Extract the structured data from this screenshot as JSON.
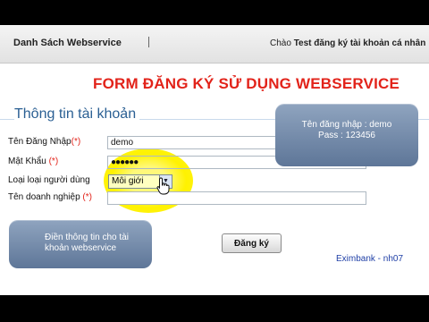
{
  "header": {
    "title": "Danh Sách Webservice",
    "greeting_prefix": "Chào",
    "greeting_rest": "Test đăng ký tài khoản cá nhân"
  },
  "form": {
    "title": "FORM ĐĂNG KÝ SỬ DỤNG WEBSERVICE",
    "section": "Thông tin tài khoản",
    "required_mark": "(*)",
    "fields": [
      {
        "label": "Tên Đăng Nhập",
        "value": "demo"
      },
      {
        "label": "Mật Khẩu",
        "value": "●●●●●●"
      },
      {
        "label": "Loại loại người dùng",
        "value": "Môi giới"
      },
      {
        "label": "Tên doanh nghiệp",
        "value": ""
      }
    ],
    "submit_label": "Đăng ký"
  },
  "annotations": {
    "login_hint_line1": "Tên đăng nhập : demo",
    "login_hint_line2": "Pass : 123456",
    "instruction": "Điền thông tin cho tài khoản webservice"
  },
  "footer": {
    "credit": "Eximbank - nh07"
  },
  "colors": {
    "title_red": "#e2231a",
    "section_blue": "#2a5f93",
    "highlight_yellow": "#fff200",
    "callout": "#6f87a9"
  }
}
